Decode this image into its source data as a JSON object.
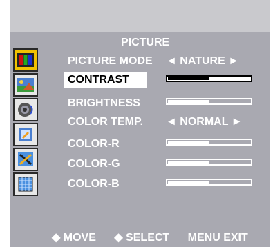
{
  "menu_title": "PICTURE",
  "items": [
    {
      "label": "PICTURE MODE",
      "value": "◄ NATURE ►"
    },
    {
      "label": "CONTRAST",
      "level": 0.5
    },
    {
      "label": "BRIGHTNESS",
      "level": 0.5
    },
    {
      "label": "COLOR TEMP.",
      "value": "◄ NORMAL ►"
    },
    {
      "label": "COLOR-R",
      "level": 0.5
    },
    {
      "label": "COLOR-G",
      "level": 0.5
    },
    {
      "label": "COLOR-B",
      "level": 0.5
    }
  ],
  "footer": {
    "move": "◆ MOVE",
    "select": "◆ SELECT",
    "menu_exit": "MENU EXIT"
  },
  "sidebar_icons": [
    "picture-icon",
    "image-icon",
    "sound-icon",
    "setup-icon",
    "tools-icon",
    "grid-icon"
  ]
}
